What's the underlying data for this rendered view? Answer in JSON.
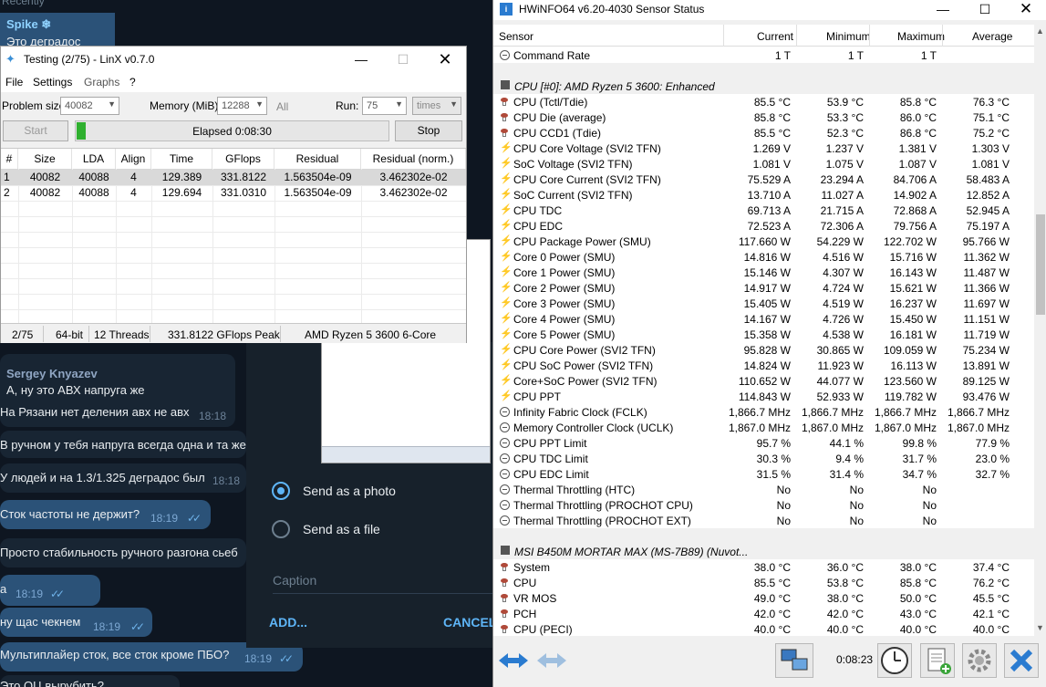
{
  "telegram": {
    "recent_label": "Recently",
    "top_msg": {
      "name": "Spike ❄",
      "text": "Это деградос"
    },
    "messages": [
      {
        "name": "Sergey Knyazev",
        "text": "А, ну это АВХ напруга же",
        "time": ""
      },
      {
        "text": "На Рязани нет деления авх не авх",
        "time": "18:18"
      },
      {
        "text": "В ручном у тебя напруга всегда одна и та же",
        "time": ""
      },
      {
        "text": "У людей и на 1.3/1.325 деградос был",
        "time": "18:18"
      },
      {
        "text": "Сток частоты не держит?",
        "time": "18:19"
      },
      {
        "text": "Просто стабильность ручного разгона сьеб",
        "time": ""
      },
      {
        "text": "a",
        "time": "18:19"
      },
      {
        "text": "ну щас чекнем",
        "time": "18:19"
      },
      {
        "text": "Мультиплайер сток, все сток кроме ПБО?",
        "time": "18:19"
      },
      {
        "text": "Это ОЦ вырубить?",
        "time": ""
      }
    ],
    "send_dialog": {
      "photo_label": "Send as a photo",
      "file_label": "Send as a file",
      "caption_label": "Caption",
      "add_label": "ADD...",
      "cancel_label": "CANCEL"
    }
  },
  "linx": {
    "title": "Testing (2/75) - LinX v0.7.0",
    "menu": [
      "File",
      "Settings",
      "Graphs",
      "?"
    ],
    "problem_label": "Problem size:",
    "problem_value": "40082",
    "memory_label": "Memory (MiB):",
    "memory_value": "12288",
    "all_label": "All",
    "run_label": "Run:",
    "run_value": "75",
    "run_unit": "times",
    "start_label": "Start",
    "stop_label": "Stop",
    "elapsed": "Elapsed 0:08:30",
    "progress_fraction": 0.03,
    "columns": [
      "#",
      "Size",
      "LDA",
      "Align",
      "Time",
      "GFlops",
      "Residual",
      "Residual (norm.)"
    ],
    "rows": [
      [
        "1",
        "40082",
        "40088",
        "4",
        "129.389",
        "331.8122",
        "1.563504e-09",
        "3.462302e-02"
      ],
      [
        "2",
        "40082",
        "40088",
        "4",
        "129.694",
        "331.0310",
        "1.563504e-09",
        "3.462302e-02"
      ]
    ],
    "status": [
      "2/75",
      "64-bit",
      "12 Threads",
      "331.8122 GFlops Peak",
      "AMD Ryzen 5 3600 6-Core"
    ]
  },
  "hwinfo": {
    "title": "HWiNFO64 v6.20-4030 Sensor Status",
    "columns": [
      "Sensor",
      "Current",
      "Minimum",
      "Maximum",
      "Average"
    ],
    "rows": [
      {
        "icon": "clock",
        "name": "Command Rate",
        "cur": "1 T",
        "min": "1 T",
        "max": "1 T",
        "avg": ""
      },
      {
        "icon": "none",
        "name": "",
        "cur": "",
        "min": "",
        "max": "",
        "avg": "",
        "blank": true
      },
      {
        "icon": "chip",
        "name": "CPU [#0]: AMD Ryzen 5 3600: Enhanced",
        "group": true
      },
      {
        "icon": "therm",
        "name": "CPU (Tctl/Tdie)",
        "cur": "85.5 °C",
        "min": "53.9 °C",
        "max": "85.8 °C",
        "avg": "76.3 °C"
      },
      {
        "icon": "therm",
        "name": "CPU Die (average)",
        "cur": "85.8 °C",
        "min": "53.3 °C",
        "max": "86.0 °C",
        "avg": "75.1 °C"
      },
      {
        "icon": "therm",
        "name": "CPU CCD1 (Tdie)",
        "cur": "85.5 °C",
        "min": "52.3 °C",
        "max": "86.8 °C",
        "avg": "75.2 °C"
      },
      {
        "icon": "volt",
        "name": "CPU Core Voltage (SVI2 TFN)",
        "cur": "1.269 V",
        "min": "1.237 V",
        "max": "1.381 V",
        "avg": "1.303 V"
      },
      {
        "icon": "volt",
        "name": "SoC Voltage (SVI2 TFN)",
        "cur": "1.081 V",
        "min": "1.075 V",
        "max": "1.087 V",
        "avg": "1.081 V"
      },
      {
        "icon": "volt",
        "name": "CPU Core Current (SVI2 TFN)",
        "cur": "75.529 A",
        "min": "23.294 A",
        "max": "84.706 A",
        "avg": "58.483 A"
      },
      {
        "icon": "volt",
        "name": "SoC Current (SVI2 TFN)",
        "cur": "13.710 A",
        "min": "11.027 A",
        "max": "14.902 A",
        "avg": "12.852 A"
      },
      {
        "icon": "volt",
        "name": "CPU TDC",
        "cur": "69.713 A",
        "min": "21.715 A",
        "max": "72.868 A",
        "avg": "52.945 A"
      },
      {
        "icon": "volt",
        "name": "CPU EDC",
        "cur": "72.523 A",
        "min": "72.306 A",
        "max": "79.756 A",
        "avg": "75.197 A"
      },
      {
        "icon": "volt",
        "name": "CPU Package Power (SMU)",
        "cur": "117.660 W",
        "min": "54.229 W",
        "max": "122.702 W",
        "avg": "95.766 W"
      },
      {
        "icon": "volt",
        "name": "Core 0 Power (SMU)",
        "cur": "14.816 W",
        "min": "4.516 W",
        "max": "15.716 W",
        "avg": "11.362 W"
      },
      {
        "icon": "volt",
        "name": "Core 1 Power (SMU)",
        "cur": "15.146 W",
        "min": "4.307 W",
        "max": "16.143 W",
        "avg": "11.487 W"
      },
      {
        "icon": "volt",
        "name": "Core 2 Power (SMU)",
        "cur": "14.917 W",
        "min": "4.724 W",
        "max": "15.621 W",
        "avg": "11.366 W"
      },
      {
        "icon": "volt",
        "name": "Core 3 Power (SMU)",
        "cur": "15.405 W",
        "min": "4.519 W",
        "max": "16.237 W",
        "avg": "11.697 W"
      },
      {
        "icon": "volt",
        "name": "Core 4 Power (SMU)",
        "cur": "14.167 W",
        "min": "4.726 W",
        "max": "15.450 W",
        "avg": "11.151 W"
      },
      {
        "icon": "volt",
        "name": "Core 5 Power (SMU)",
        "cur": "15.358 W",
        "min": "4.538 W",
        "max": "16.181 W",
        "avg": "11.719 W"
      },
      {
        "icon": "volt",
        "name": "CPU Core Power (SVI2 TFN)",
        "cur": "95.828 W",
        "min": "30.865 W",
        "max": "109.059 W",
        "avg": "75.234 W"
      },
      {
        "icon": "volt",
        "name": "CPU SoC Power (SVI2 TFN)",
        "cur": "14.824 W",
        "min": "11.923 W",
        "max": "16.113 W",
        "avg": "13.891 W"
      },
      {
        "icon": "volt",
        "name": "Core+SoC Power (SVI2 TFN)",
        "cur": "110.652 W",
        "min": "44.077 W",
        "max": "123.560 W",
        "avg": "89.125 W"
      },
      {
        "icon": "volt",
        "name": "CPU PPT",
        "cur": "114.843 W",
        "min": "52.933 W",
        "max": "119.782 W",
        "avg": "93.476 W"
      },
      {
        "icon": "clock",
        "name": "Infinity Fabric Clock (FCLK)",
        "cur": "1,866.7 MHz",
        "min": "1,866.7 MHz",
        "max": "1,866.7 MHz",
        "avg": "1,866.7 MHz"
      },
      {
        "icon": "clock",
        "name": "Memory Controller Clock (UCLK)",
        "cur": "1,867.0 MHz",
        "min": "1,867.0 MHz",
        "max": "1,867.0 MHz",
        "avg": "1,867.0 MHz"
      },
      {
        "icon": "clock",
        "name": "CPU PPT Limit",
        "cur": "95.7 %",
        "min": "44.1 %",
        "max": "99.8 %",
        "avg": "77.9 %"
      },
      {
        "icon": "clock",
        "name": "CPU TDC Limit",
        "cur": "30.3 %",
        "min": "9.4 %",
        "max": "31.7 %",
        "avg": "23.0 %"
      },
      {
        "icon": "clock",
        "name": "CPU EDC Limit",
        "cur": "31.5 %",
        "min": "31.4 %",
        "max": "34.7 %",
        "avg": "32.7 %"
      },
      {
        "icon": "clock",
        "name": "Thermal Throttling (HTC)",
        "cur": "No",
        "min": "No",
        "max": "No",
        "avg": ""
      },
      {
        "icon": "clock",
        "name": "Thermal Throttling (PROCHOT CPU)",
        "cur": "No",
        "min": "No",
        "max": "No",
        "avg": ""
      },
      {
        "icon": "clock",
        "name": "Thermal Throttling (PROCHOT EXT)",
        "cur": "No",
        "min": "No",
        "max": "No",
        "avg": ""
      },
      {
        "icon": "none",
        "name": "",
        "cur": "",
        "min": "",
        "max": "",
        "avg": "",
        "blank": true
      },
      {
        "icon": "chip",
        "name": "MSI B450M MORTAR MAX (MS-7B89) (Nuvot...",
        "group": true
      },
      {
        "icon": "therm",
        "name": "System",
        "cur": "38.0 °C",
        "min": "36.0 °C",
        "max": "38.0 °C",
        "avg": "37.4 °C"
      },
      {
        "icon": "therm",
        "name": "CPU",
        "cur": "85.5 °C",
        "min": "53.8 °C",
        "max": "85.8 °C",
        "avg": "76.2 °C"
      },
      {
        "icon": "therm",
        "name": "VR MOS",
        "cur": "49.0 °C",
        "min": "38.0 °C",
        "max": "50.0 °C",
        "avg": "45.5 °C"
      },
      {
        "icon": "therm",
        "name": "PCH",
        "cur": "42.0 °C",
        "min": "42.0 °C",
        "max": "43.0 °C",
        "avg": "42.1 °C"
      },
      {
        "icon": "therm",
        "name": "CPU (PECI)",
        "cur": "40.0 °C",
        "min": "40.0 °C",
        "max": "40.0 °C",
        "avg": "40.0 °C"
      }
    ],
    "timer": "0:08:23"
  }
}
